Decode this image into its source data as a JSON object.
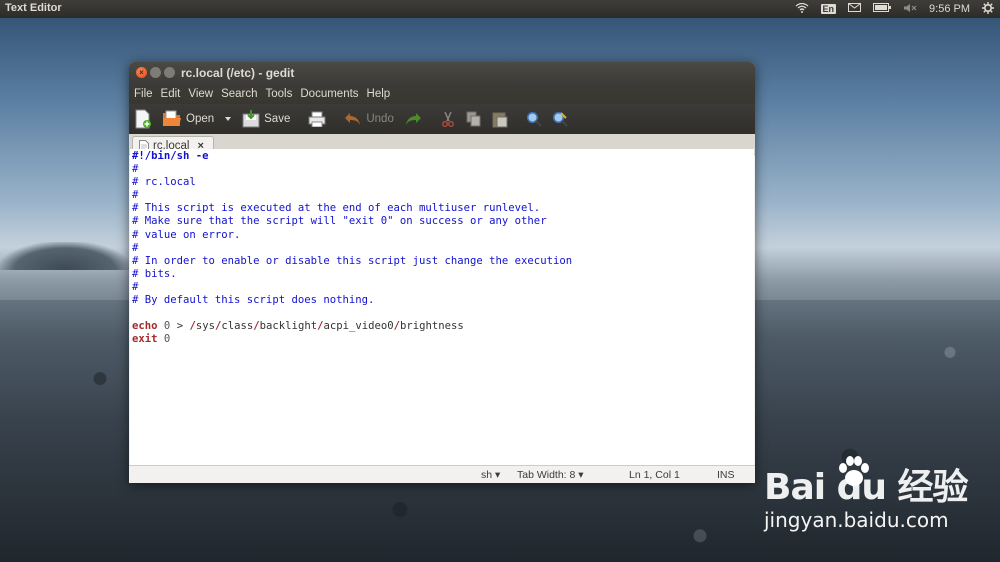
{
  "panel": {
    "app_title": "Text Editor",
    "lang": "En",
    "clock": "9:56 PM"
  },
  "window": {
    "title": "rc.local (/etc) - gedit"
  },
  "menu": [
    "File",
    "Edit",
    "View",
    "Search",
    "Tools",
    "Documents",
    "Help"
  ],
  "toolbar": {
    "open_label": "Open",
    "save_label": "Save",
    "undo_label": "Undo"
  },
  "tab": {
    "label": "rc.local",
    "close": "×"
  },
  "editor": {
    "lines": [
      "#!/bin/sh -e",
      "#",
      "# rc.local",
      "#",
      "# This script is executed at the end of each multiuser runlevel.",
      "# Make sure that the script will \"exit 0\" on success or any other",
      "# value on error.",
      "#",
      "# In order to enable or disable this script just change the execution",
      "# bits.",
      "#",
      "# By default this script does nothing.",
      "",
      "echo 0 > /sys/class/backlight/acpi_video0/brightness",
      "exit 0"
    ]
  },
  "status": {
    "language": "sh",
    "tab_width": "Tab Width: 8",
    "position": "Ln 1, Col 1",
    "mode": "INS"
  },
  "watermark": {
    "logo": "Bai du 经验",
    "url": "jingyan.baidu.com"
  }
}
